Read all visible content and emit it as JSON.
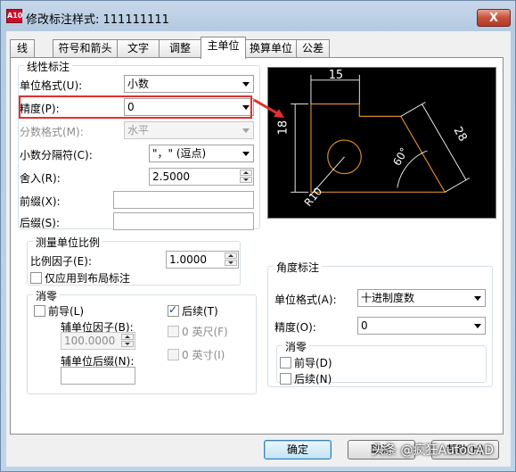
{
  "window": {
    "title": "修改标注样式: 111111111",
    "close_label": "X",
    "app_icon_label": "A10"
  },
  "tabs": [
    {
      "label": "线"
    },
    {
      "label": "符号和箭头"
    },
    {
      "label": "文字"
    },
    {
      "label": "调整"
    },
    {
      "label": "主单位",
      "active": true
    },
    {
      "label": "换算单位"
    },
    {
      "label": "公差"
    }
  ],
  "linear": {
    "group_label": "线性标注",
    "unit_format": {
      "label": "单位格式(U):",
      "value": "小数"
    },
    "precision": {
      "label": "精度(P):",
      "value": "0"
    },
    "fraction_format": {
      "label": "分数格式(M):",
      "value": "水平"
    },
    "decimal_separator": {
      "label": "小数分隔符(C):",
      "value": "\"，\"  (逗点)"
    },
    "round_off": {
      "label": "舍入(R):",
      "value": "2.5000"
    },
    "prefix": {
      "label": "前缀(X):",
      "value": ""
    },
    "suffix": {
      "label": "后缀(S):",
      "value": ""
    }
  },
  "scale": {
    "group_label": "测量单位比例",
    "scale_factor": {
      "label": "比例因子(E):",
      "value": "1.0000"
    },
    "layout_only": {
      "label": "仅应用到布局标注",
      "checked": false
    }
  },
  "zero_suppression": {
    "group_label": "消零",
    "leading": {
      "label": "前导(L)",
      "checked": false
    },
    "trailing": {
      "label": "后续(T)",
      "checked": true
    },
    "sub_unit_factor": {
      "label": "辅单位因子(B):",
      "value": "100.0000"
    },
    "sub_unit_suffix": {
      "label": "辅单位后缀(N):",
      "value": ""
    },
    "feet": {
      "label": "0 英尺(F)",
      "checked": false
    },
    "inches": {
      "label": "0 英寸(I)",
      "checked": false
    }
  },
  "angular": {
    "group_label": "角度标注",
    "unit_format": {
      "label": "单位格式(A):",
      "value": "十进制度数"
    },
    "precision": {
      "label": "精度(O):",
      "value": "0"
    },
    "zero_group_label": "消零",
    "leading": {
      "label": "前导(D)",
      "checked": false
    },
    "trailing": {
      "label": "后续(N)",
      "checked": false
    }
  },
  "preview": {
    "dim_top": "15",
    "dim_left": "18",
    "dim_right": "28",
    "dim_angle": "60°",
    "dim_radius": "R10",
    "colors": {
      "bg": "#000000",
      "geometry": "#d58a2a",
      "dimension": "#ffffff"
    }
  },
  "buttons": {
    "ok": "确定",
    "cancel": "取消",
    "help": "帮助(H)"
  },
  "watermark": "头条 @疯狂AutoCAD"
}
